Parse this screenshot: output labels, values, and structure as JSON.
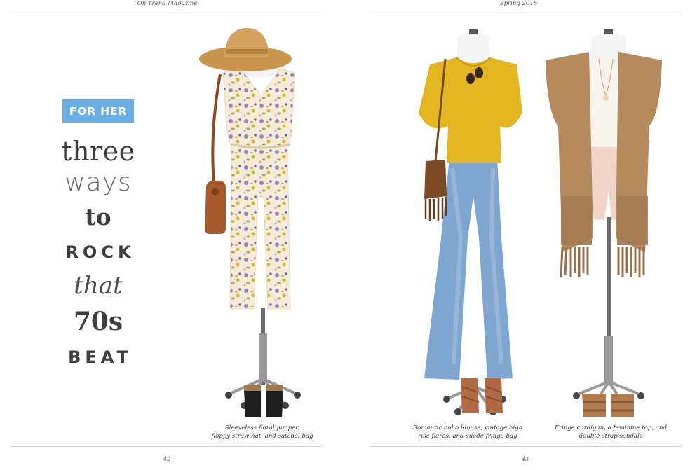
{
  "spread": {
    "left_page": {
      "running_head": "On Trend Magazine",
      "page_number": "42",
      "badge": "FOR HER",
      "headline": {
        "line1": "three",
        "line2": "ways",
        "line3": "to",
        "line4": "ROCK",
        "line5": "that",
        "line6": "70s",
        "line7": "BEAT"
      },
      "look1_caption": {
        "line1": "Sleeveless floral jumper,",
        "line2": "floppy straw hat, and satchel bag"
      }
    },
    "right_page": {
      "running_head": "Spring 2016",
      "page_number": "43",
      "look2_caption": {
        "line1": "Romantic boho blouse, vintage high",
        "line2": "rise flares, and suede fringe bag"
      },
      "look3_caption": {
        "line1": "Fringe cardigan, a feminine top, and",
        "line2": "double-strap sandals"
      }
    }
  },
  "colors": {
    "badge": "#6aaee4",
    "headline_text": "#3d3d3d",
    "rule": "#cfcfcf",
    "straw_hat": "#c9954f",
    "satchel": "#a65a2e",
    "floral_base": "#f4ecd8",
    "blouse_yellow": "#e2b521",
    "denim": "#7ea6cf",
    "fringe_bag": "#7b4a24",
    "cardigan": "#b48a5e",
    "shorts_pink": "#f0d4c8",
    "sandals": "#b06a45"
  }
}
